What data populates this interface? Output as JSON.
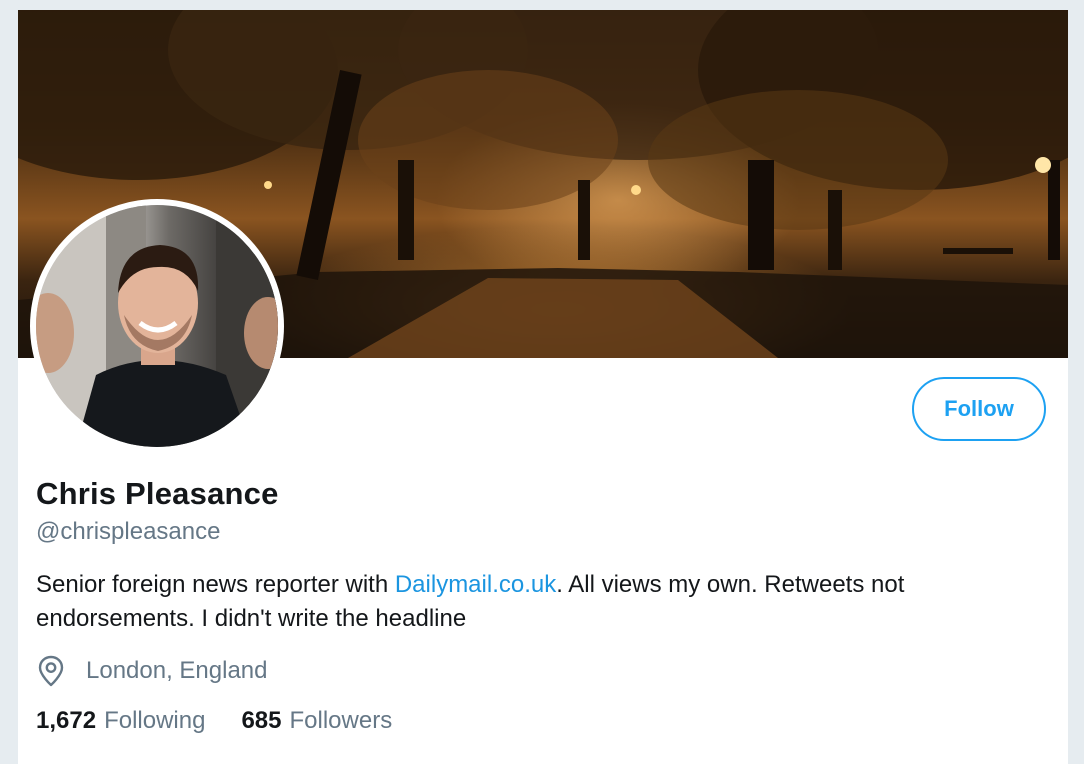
{
  "profile": {
    "name": "Chris Pleasance",
    "handle": "@chrispleasance",
    "bio_before_link": "Senior foreign news reporter with ",
    "bio_link": "Dailymail.co.uk",
    "bio_after_link": ". All views my own. Retweets not endorsements. I didn't write the headline",
    "location": "London, England",
    "follow_label": "Follow",
    "following_count": "1,672",
    "following_label": "Following",
    "followers_count": "685",
    "followers_label": "Followers"
  },
  "icons": {
    "location": "location-pin-icon"
  },
  "colors": {
    "accent": "#1da1f2",
    "link": "#1b95e0",
    "text": "#14171a",
    "muted": "#657786",
    "page_background": "#e6ecf0"
  }
}
